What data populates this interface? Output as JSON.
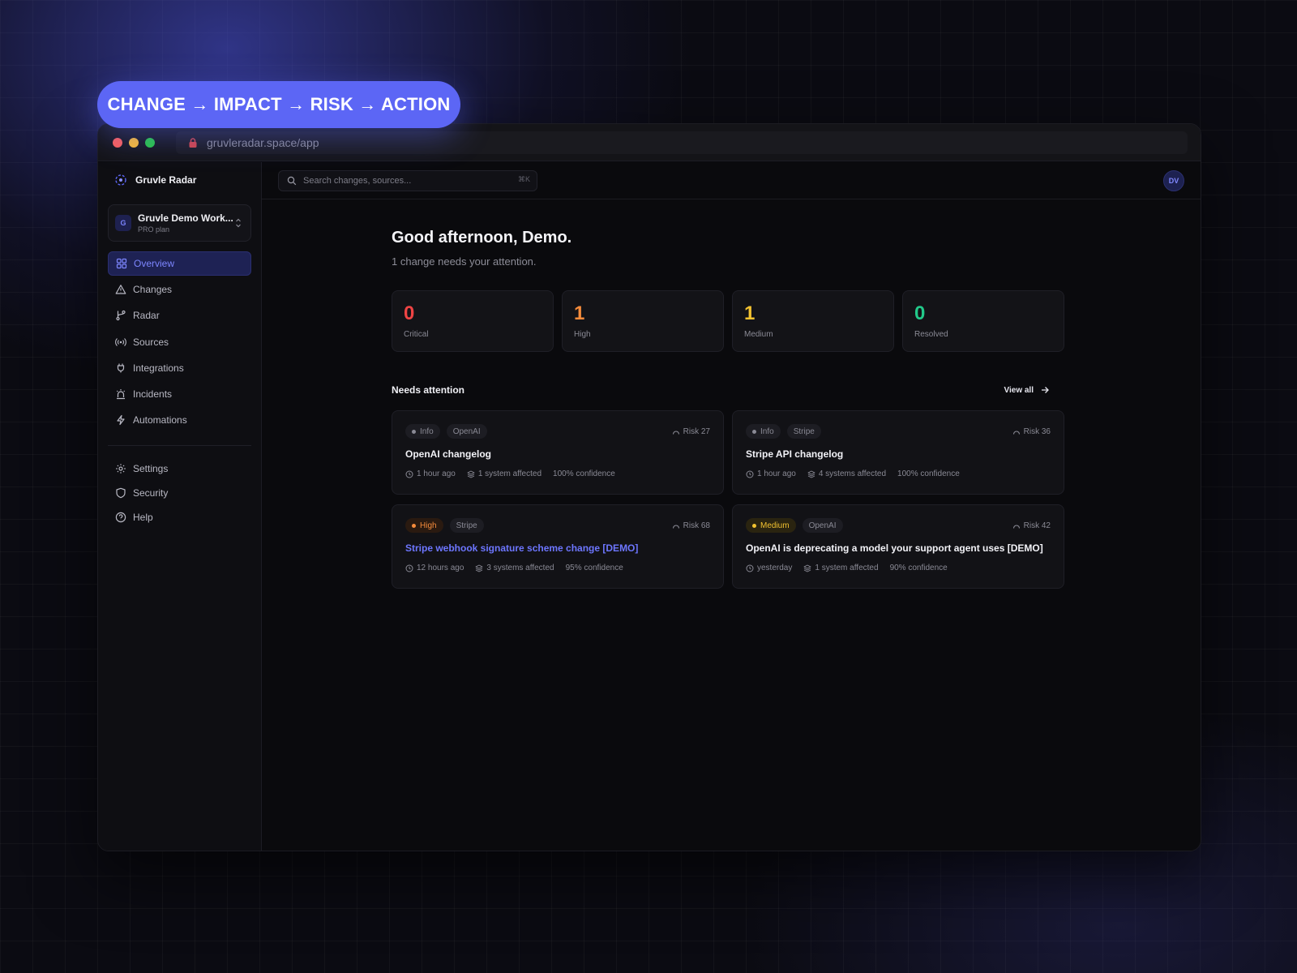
{
  "banner": {
    "text": "CHANGE → IMPACT → RISK → ACTION"
  },
  "browser": {
    "url": "gruvleradar.space/app"
  },
  "brand": {
    "name": "Gruvle Radar"
  },
  "workspace": {
    "avatar": "G",
    "name": "Gruvle Demo Work...",
    "plan": "PRO plan"
  },
  "nav": {
    "items": [
      {
        "label": "Overview",
        "icon": "grid-icon"
      },
      {
        "label": "Changes",
        "icon": "warning-triangle-icon"
      },
      {
        "label": "Radar",
        "icon": "git-branch-icon"
      },
      {
        "label": "Sources",
        "icon": "broadcast-icon"
      },
      {
        "label": "Integrations",
        "icon": "plug-icon"
      },
      {
        "label": "Incidents",
        "icon": "siren-icon"
      },
      {
        "label": "Automations",
        "icon": "lightning-icon"
      }
    ],
    "secondary": [
      {
        "label": "Settings",
        "icon": "gear-icon"
      },
      {
        "label": "Security",
        "icon": "shield-icon"
      },
      {
        "label": "Help",
        "icon": "help-circle-icon"
      }
    ]
  },
  "search": {
    "placeholder": "Search changes, sources...",
    "shortcut": "⌘K"
  },
  "user": {
    "initials": "DV"
  },
  "main": {
    "greeting": "Good afternoon, Demo.",
    "subtitle": "1 change needs your attention."
  },
  "stats": [
    {
      "value": "0",
      "label": "Critical",
      "color": "#ef4444"
    },
    {
      "value": "1",
      "label": "High",
      "color": "#f58b3b"
    },
    {
      "value": "1",
      "label": "Medium",
      "color": "#f2c230"
    },
    {
      "value": "0",
      "label": "Resolved",
      "color": "#22c98a"
    }
  ],
  "attention": {
    "title": "Needs attention",
    "view_all": "View all",
    "cards": [
      {
        "severity": "Info",
        "source": "OpenAI",
        "risk": "Risk 27",
        "title": "OpenAI changelog",
        "time": "1 hour ago",
        "affected": "1 system affected",
        "confidence": "100% confidence"
      },
      {
        "severity": "Info",
        "source": "Stripe",
        "risk": "Risk 36",
        "title": "Stripe API changelog",
        "time": "1 hour ago",
        "affected": "4 systems affected",
        "confidence": "100% confidence"
      },
      {
        "severity": "High",
        "source": "Stripe",
        "risk": "Risk 68",
        "title": "Stripe webhook signature scheme change [DEMO]",
        "time": "12 hours ago",
        "affected": "3 systems affected",
        "confidence": "95% confidence"
      },
      {
        "severity": "Medium",
        "source": "OpenAI",
        "risk": "Risk 42",
        "title": "OpenAI is deprecating a model your support agent uses [DEMO]",
        "time": "yesterday",
        "affected": "1 system affected",
        "confidence": "90% confidence"
      }
    ]
  },
  "colors": {
    "accent": "#5c66f5",
    "link": "#6d76ff",
    "background": "#0a0a0d"
  }
}
